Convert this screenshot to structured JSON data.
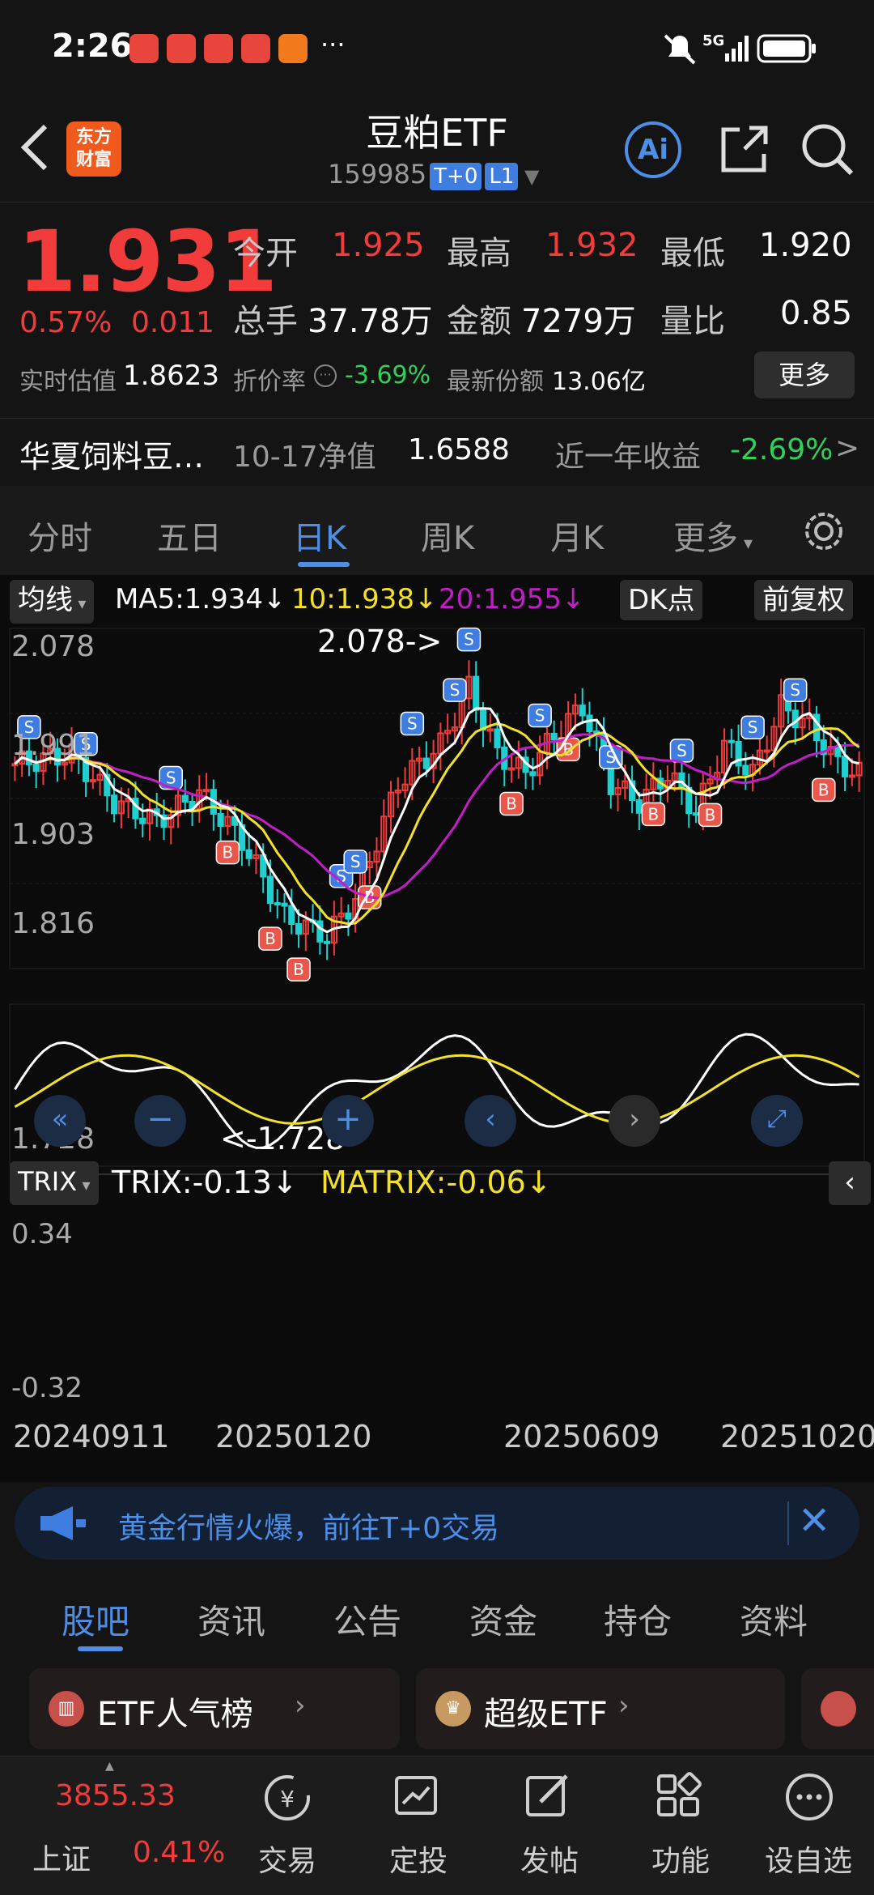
{
  "status": {
    "time": "2:26",
    "signal": "5G"
  },
  "header": {
    "title": "豆粕ETF",
    "code": "159985",
    "tag1": "T+0",
    "tag2": "L1",
    "logo_line1": "东方",
    "logo_line2": "财富",
    "ai": "Ai"
  },
  "quote": {
    "price": "1.931",
    "pct": "0.57%",
    "chg": "0.011",
    "open_l": "今开",
    "open": "1.925",
    "high_l": "最高",
    "high": "1.932",
    "low_l": "最低",
    "low": "1.920",
    "vol_l": "总手",
    "vol": "37.78万",
    "amt_l": "金额",
    "amt": "7279万",
    "ratio_l": "量比",
    "ratio": "0.85",
    "iopv_l": "实时估值",
    "iopv": "1.8623",
    "prem_l": "折价率",
    "prem": "-3.69%",
    "share_l": "最新份额",
    "share": "13.06亿",
    "more": "更多"
  },
  "fund": {
    "name": "华夏饲料豆…",
    "nav_l": "10-17净值",
    "nav": "1.6588",
    "yr_l": "近一年收益",
    "yr": "-2.69%"
  },
  "tabs": [
    "分时",
    "五日",
    "日K",
    "周K",
    "月K",
    "更多"
  ],
  "ma": {
    "label": "均线",
    "ma5": "MA5:1.934↓",
    "ma10": "10:1.938↓",
    "ma20": "20:1.955↓",
    "dk": "DK点",
    "fq": "前复权"
  },
  "kaxis": {
    "t1": "2.078",
    "t2": "1.991",
    "t3": "1.903",
    "t4": "1.816",
    "t5": "1.728",
    "hi": "2.078->",
    "lo": "<-1.728"
  },
  "trix": {
    "label": "TRIX",
    "trix": "TRIX:-0.13↓",
    "matrix": "MATRIX:-0.06↓",
    "t1": "0.34",
    "t2": "-0.32"
  },
  "dates": [
    "20240911",
    "20250120",
    "20250609",
    "20251020"
  ],
  "colors": {
    "up": "#f23b3b",
    "down": "#2fd15a",
    "accent": "#4d8fe8",
    "ma5": "#ffffff",
    "ma10": "#f2e12a",
    "ma20": "#c21ec8"
  },
  "banner": {
    "text": "黄金行情火爆，前往T+0交易"
  },
  "btabs": [
    "股吧",
    "资讯",
    "公告",
    "资金",
    "持仓",
    "资料"
  ],
  "cards": [
    "ETF人气榜",
    "超级ETF"
  ],
  "index": {
    "value": "3855.33",
    "name": "上证",
    "pct": "0.41%"
  },
  "bottom": [
    "交易",
    "定投",
    "发帖",
    "功能",
    "设自选"
  ]
}
